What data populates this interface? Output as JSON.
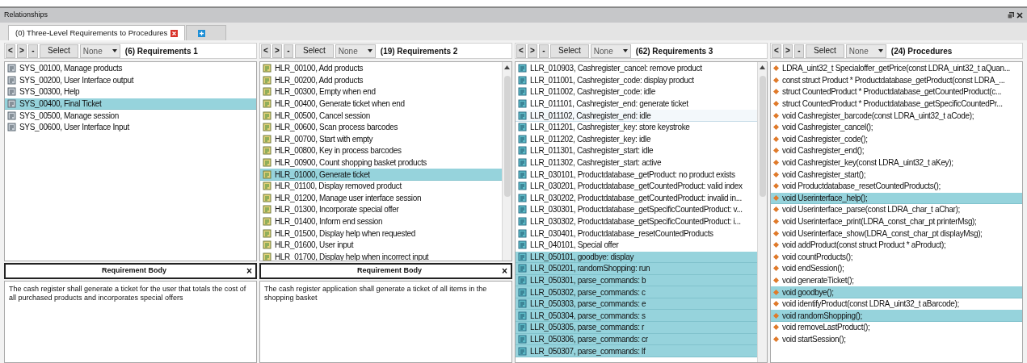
{
  "window": {
    "title": "Relationships"
  },
  "tabs": [
    {
      "label": "(0) Three-Level Requirements to Procedures",
      "kind": "view",
      "selected": true
    },
    {
      "kind": "add",
      "selected": false
    }
  ],
  "columns": [
    {
      "title": "(6) Requirements 1",
      "kind": "system",
      "nav": [
        "<",
        ">",
        "-"
      ],
      "select": "Select",
      "filter": "None",
      "items": [
        {
          "label": "SYS_00100, Manage products",
          "selected": false
        },
        {
          "label": "SYS_00200, User Interface output",
          "selected": false
        },
        {
          "label": "SYS_00300, Help",
          "selected": false
        },
        {
          "label": "SYS_00400, Final Ticket",
          "selected": true
        },
        {
          "label": "SYS_00500, Manage session",
          "selected": false
        },
        {
          "label": "SYS_00600, User Interface Input",
          "selected": false
        }
      ],
      "body": {
        "title": "Requirement Body",
        "close": "×",
        "text": "The cash register shall generate a ticket for the user that totals the cost of all purchased products and incorporates special offers"
      }
    },
    {
      "title": "(19) Requirements 2",
      "kind": "high",
      "nav": [
        "<",
        ">",
        "-"
      ],
      "select": "Select",
      "filter": "None",
      "items": [
        {
          "label": "HLR_00100, Add products",
          "selected": false
        },
        {
          "label": "HLR_00200, Add products",
          "selected": false
        },
        {
          "label": "HLR_00300, Empty when end",
          "selected": false
        },
        {
          "label": "HLR_00400, Generate ticket when end",
          "selected": false
        },
        {
          "label": "HLR_00500, Cancel session",
          "selected": false
        },
        {
          "label": "HLR_00600, Scan process barcodes",
          "selected": false
        },
        {
          "label": "HLR_00700, Start with empty",
          "selected": false
        },
        {
          "label": "HLR_00800, Key in process barcodes",
          "selected": false
        },
        {
          "label": "HLR_00900, Count shopping basket products",
          "selected": false
        },
        {
          "label": "HLR_01000, Generate ticket",
          "selected": true
        },
        {
          "label": "HLR_01100, Display removed product",
          "selected": false
        },
        {
          "label": "HLR_01200, Manage user interface session",
          "selected": false
        },
        {
          "label": "HLR_01300, Incorporate special offer",
          "selected": false
        },
        {
          "label": "HLR_01400, Inform end session",
          "selected": false
        },
        {
          "label": "HLR_01500, Display help when requested",
          "selected": false
        },
        {
          "label": "HLR_01600, User input",
          "selected": false
        },
        {
          "label": "HLR_01700, Display help when incorrect input",
          "selected": false
        }
      ],
      "body": {
        "title": "Requirement Body",
        "close": "×",
        "text": "The cash register application shall generate a ticket of all items in the shopping basket"
      }
    },
    {
      "title": "(62) Requirements 3",
      "kind": "low",
      "nav": [
        "<",
        ">",
        "-"
      ],
      "select": "Select",
      "filter": "None",
      "items": [
        {
          "label": "LLR_010903, Cashregister_cancel: remove product",
          "selected": false
        },
        {
          "label": "LLR_011001, Cashregister_code: display product",
          "selected": false
        },
        {
          "label": "LLR_011002, Cashregister_code: idle",
          "selected": false
        },
        {
          "label": "LLR_011101, Cashregister_end: generate ticket",
          "selected": false
        },
        {
          "label": "LLR_011102, Cashregister_end: idle",
          "selected": false,
          "hovered": true
        },
        {
          "label": "LLR_011201, Cashregister_key: store keystroke",
          "selected": false
        },
        {
          "label": "LLR_011202, Cashregister_key: idle",
          "selected": false
        },
        {
          "label": "LLR_011301, Cashregister_start: idle",
          "selected": false
        },
        {
          "label": "LLR_011302, Cashregister_start: active",
          "selected": false
        },
        {
          "label": "LLR_030101, Productdatabase_getProduct: no product exists",
          "selected": false
        },
        {
          "label": "LLR_030201, Productdatabase_getCountedProduct: valid index",
          "selected": false
        },
        {
          "label": "LLR_030202, Productdatabase_getCountedProduct: invalid in...",
          "selected": false
        },
        {
          "label": "LLR_030301, Productdatabase_getSpecificCountedProduct: v...",
          "selected": false
        },
        {
          "label": "LLR_030302, Productdatabase_getSpecificCountedProduct: i...",
          "selected": false
        },
        {
          "label": "LLR_030401, Productdatabase_resetCountedProducts",
          "selected": false
        },
        {
          "label": "LLR_040101, Special offer",
          "selected": false
        },
        {
          "label": "LLR_050101, goodbye: display",
          "selected": true
        },
        {
          "label": "LLR_050201, randomShopping: run",
          "selected": true
        },
        {
          "label": "LLR_050301, parse_commands: b",
          "selected": true
        },
        {
          "label": "LLR_050302, parse_commands: c",
          "selected": true
        },
        {
          "label": "LLR_050303, parse_commands: e",
          "selected": true
        },
        {
          "label": "LLR_050304, parse_commands: s",
          "selected": true
        },
        {
          "label": "LLR_050305, parse_commands: r",
          "selected": true
        },
        {
          "label": "LLR_050306, parse_commands: cr",
          "selected": true
        },
        {
          "label": "LLR_050307, parse_commands: lf",
          "selected": true
        }
      ]
    },
    {
      "title": "(24) Procedures",
      "kind": "procedure",
      "nav": [
        "<",
        ">",
        "-"
      ],
      "select": "Select",
      "filter": "None",
      "items": [
        {
          "label": "LDRA_uint32_t Specialoffer_getPrice(const LDRA_uint32_t aQuan...",
          "selected": false
        },
        {
          "label": "const struct Product * Productdatabase_getProduct(const LDRA_...",
          "selected": false
        },
        {
          "label": "struct CountedProduct * Productdatabase_getCountedProduct(c...",
          "selected": false
        },
        {
          "label": "struct CountedProduct * Productdatabase_getSpecificCountedPr...",
          "selected": false
        },
        {
          "label": "void Cashregister_barcode(const LDRA_uint32_t aCode);",
          "selected": false
        },
        {
          "label": "void Cashregister_cancel();",
          "selected": false
        },
        {
          "label": "void Cashregister_code();",
          "selected": false
        },
        {
          "label": "void Cashregister_end();",
          "selected": false
        },
        {
          "label": "void Cashregister_key(const LDRA_uint32_t aKey);",
          "selected": false
        },
        {
          "label": "void Cashregister_start();",
          "selected": false
        },
        {
          "label": "void Productdatabase_resetCountedProducts();",
          "selected": false
        },
        {
          "label": "void Userinterface_help();",
          "selected": true
        },
        {
          "label": "void Userinterface_parse(const LDRA_char_t aChar);",
          "selected": false
        },
        {
          "label": "void Userinterface_print(LDRA_const_char_pt printerMsg);",
          "selected": false
        },
        {
          "label": "void Userinterface_show(LDRA_const_char_pt displayMsg);",
          "selected": false
        },
        {
          "label": "void addProduct(const struct Product * aProduct);",
          "selected": false
        },
        {
          "label": "void countProducts();",
          "selected": false
        },
        {
          "label": "void endSession();",
          "selected": false
        },
        {
          "label": "void generateTicket();",
          "selected": false
        },
        {
          "label": "void goodbye();",
          "selected": true
        },
        {
          "label": "void identifyProduct(const LDRA_uint32_t aBarcode);",
          "selected": false
        },
        {
          "label": "void randomShopping();",
          "selected": true
        },
        {
          "label": "void removeLastProduct();",
          "selected": false
        },
        {
          "label": "void startSession();",
          "selected": false
        }
      ]
    }
  ]
}
